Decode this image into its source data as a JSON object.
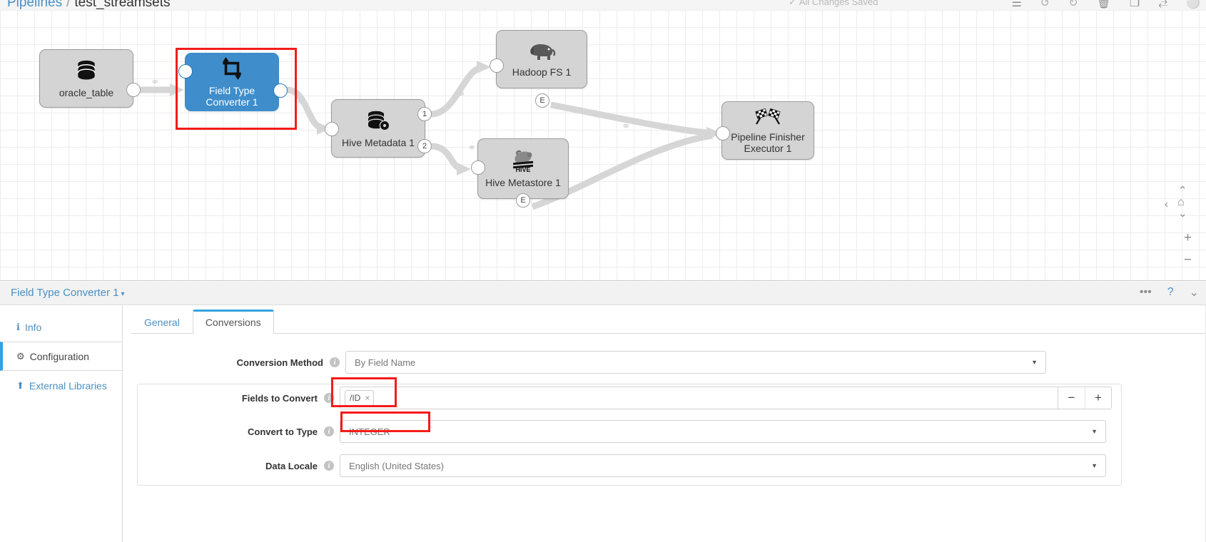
{
  "topbar": {
    "breadcrumb_root": "Pipelines",
    "breadcrumb_sep": "/",
    "breadcrumb_current": "test_streamsets",
    "save_status": "All Changes Saved",
    "save_status_icon": "check-circle-icon",
    "icons": [
      {
        "name": "notes-icon",
        "glyph": "☰"
      },
      {
        "name": "undo-icon",
        "glyph": "↺"
      },
      {
        "name": "redo-icon",
        "glyph": "↻"
      },
      {
        "name": "delete-icon",
        "glyph": "🗑"
      },
      {
        "name": "duplicate-icon",
        "glyph": "❐"
      },
      {
        "name": "auto-arrange-icon",
        "glyph": "⥄"
      },
      {
        "name": "user-icon",
        "glyph": "⚪"
      }
    ]
  },
  "canvas": {
    "nodes": [
      {
        "id": "oracle_table",
        "label": "oracle_table",
        "icon": "database-icon",
        "type": "origin",
        "selected": false
      },
      {
        "id": "field_type_converter_1",
        "label": "Field Type Converter 1",
        "icon": "transform-crop-icon",
        "type": "processor",
        "selected": true
      },
      {
        "id": "hive_metadata_1",
        "label": "Hive Metadata 1",
        "icon": "database-gear-icon",
        "type": "processor",
        "selected": false
      },
      {
        "id": "hadoop_fs_1",
        "label": "Hadoop FS 1",
        "icon": "hadoop-elephant-icon",
        "type": "destination",
        "selected": false
      },
      {
        "id": "hive_metastore_1",
        "label": "Hive Metastore 1",
        "icon": "hive-bee-icon",
        "type": "destination",
        "selected": false
      },
      {
        "id": "pipeline_finisher_executor_1",
        "label": "Pipeline Finisher Executor 1",
        "icon": "checkered-flags-icon",
        "type": "executor",
        "selected": false
      }
    ],
    "output_port_labels": [
      "1",
      "2"
    ],
    "error_port_label": "E",
    "nav_controls": {
      "pan_left": "‹",
      "pan_home": "⌂",
      "pan_up": "⌃",
      "pan_down": "⌄",
      "zoom_in": "+",
      "zoom_out": "−"
    }
  },
  "panel": {
    "title": "Field Type Converter 1",
    "title_caret": "▾",
    "header_icons": [
      {
        "name": "more-options-icon",
        "glyph": "•••"
      },
      {
        "name": "help-icon",
        "glyph": "?"
      },
      {
        "name": "collapse-panel-icon",
        "glyph": "⌄"
      }
    ],
    "side_tabs": [
      {
        "name": "info",
        "label": "Info",
        "icon": "info-icon",
        "glyph": "ℹ",
        "active": false
      },
      {
        "name": "configuration",
        "label": "Configuration",
        "icon": "gear-icon",
        "glyph": "⚙",
        "active": true
      },
      {
        "name": "external-libraries",
        "label": "External Libraries",
        "icon": "upload-icon",
        "glyph": "⬆",
        "active": false
      }
    ],
    "tabs": [
      {
        "name": "general",
        "label": "General",
        "active": false
      },
      {
        "name": "conversions",
        "label": "Conversions",
        "active": true
      }
    ],
    "fields": [
      {
        "name": "conversion-method",
        "label": "Conversion Method",
        "control": "select",
        "value": "By Field Name",
        "highlighted": false
      },
      {
        "name": "fields-to-convert",
        "label": "Fields to Convert",
        "control": "tags",
        "tags": [
          "/ID"
        ],
        "tag_remove_glyph": "×",
        "highlighted": true
      },
      {
        "name": "convert-to-type",
        "label": "Convert to Type",
        "control": "select",
        "value": "INTEGER",
        "highlighted": true
      },
      {
        "name": "data-locale",
        "label": "Data Locale",
        "control": "select",
        "value": "English (United States)",
        "highlighted": false
      }
    ],
    "list_controls": {
      "remove_label": "−",
      "add_label": "+"
    }
  },
  "colors": {
    "accent_blue": "#3f8dcb",
    "link_blue": "#4a90c4",
    "tab_active_blue": "#32a3e0",
    "highlight_red": "#f51b1b",
    "node_grey": "#d4d4d4",
    "canvas_grid": "#ededed"
  }
}
